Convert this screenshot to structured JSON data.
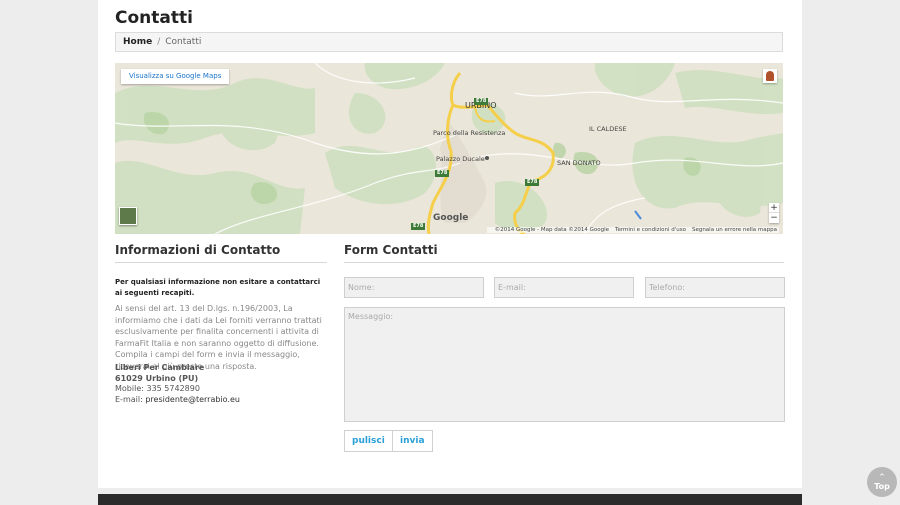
{
  "page": {
    "title": "Contatti"
  },
  "breadcrumb": {
    "home": "Home",
    "separator": "/",
    "current": "Contatti"
  },
  "map": {
    "view_link": "Visualizza su Google Maps",
    "logo": "Google",
    "attribution": "©2014 Google - Map data ©2014 Google",
    "terms": "Termini e condizioni d'uso",
    "report": "Segnala un errore nella mappa",
    "zoom_in": "+",
    "zoom_out": "−",
    "labels": {
      "urbino": "URBINO",
      "parco": "Parco della Resistenza",
      "palazzo": "Palazzo Ducale",
      "caldese": "IL CALDESE",
      "san_donato": "SAN DONATO",
      "road1": "E78",
      "road2": "E78",
      "road3": "E78",
      "road4": "E78"
    },
    "pegman_icon": "pegman-icon",
    "satellite_icon": "satellite-thumbnail"
  },
  "info": {
    "title": "Informazioni di Contatto",
    "lead": "Per qualsiasi informazione non esitare a contattarci ai seguenti recapiti.",
    "legal": "Ai sensi del art. 13 del D.lgs. n.196/2003, La informiamo che i dati da Lei forniti verranno trattati esclusivamente per finalita concernenti i attivita di FarmaFit Italia e non saranno oggetto di diffusione. Compila i campi del form e invia il messaggio, riceverai al più presto una risposta.",
    "org": "Liberi Per Cambiare",
    "city": "61029 Urbino (PU)",
    "mobile": "Mobile: 335 5742890",
    "email_label": "E-mail: ",
    "email": "presidente@terrabio.eu"
  },
  "form": {
    "title": "Form Contatti",
    "name_placeholder": "Nome:",
    "email_placeholder": "E-mail:",
    "phone_placeholder": "Telefono:",
    "message_placeholder": "Messaggio:",
    "clear_label": "pulisci",
    "send_label": "invia"
  },
  "top_button": {
    "arrow": "^",
    "label": "Top"
  },
  "colors": {
    "accent": "#2a9fd8",
    "footer": "#2b2b2b",
    "road": "#f5cf4a"
  }
}
